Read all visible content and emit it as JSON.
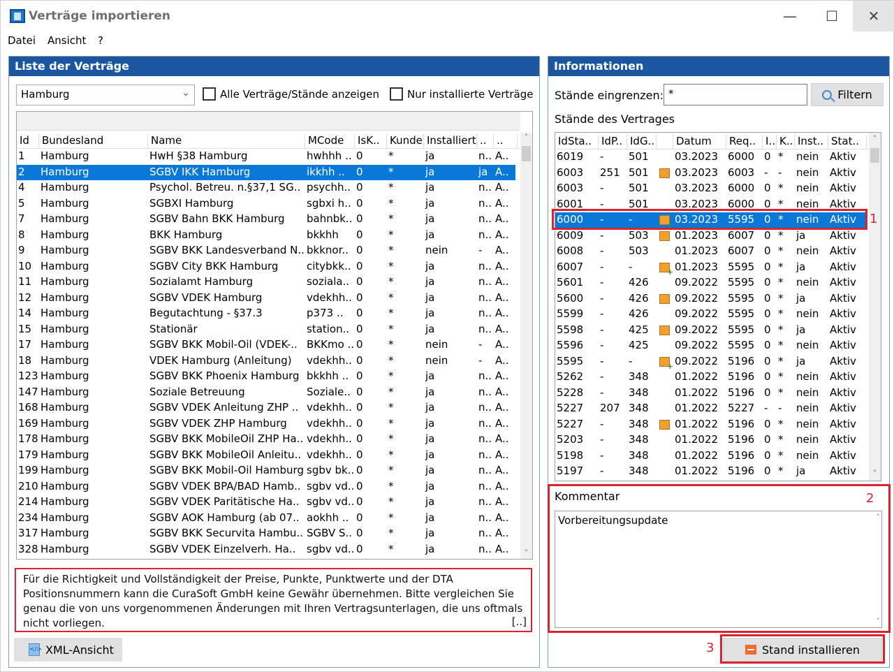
{
  "window": {
    "title": "Verträge importieren",
    "min_glyph": "—",
    "max_glyph": "☐",
    "close_glyph": "✕"
  },
  "menu": [
    "Datei",
    "Ansicht",
    "?"
  ],
  "left_panel": {
    "header": "Liste der Verträge",
    "region_select": {
      "value": "Hamburg"
    },
    "checkbox_all": {
      "label": "Alle Verträge/Stände anzeigen",
      "checked": false
    },
    "checkbox_installed": {
      "label": "Nur installierte Verträge",
      "checked": false
    },
    "columns": [
      "Id",
      "Bundesland",
      "Name",
      "MCode",
      "IsK..",
      "Kunde",
      "Installiert",
      "..",
      ".."
    ],
    "selected_row": 1,
    "rows": [
      [
        "1",
        "Hamburg",
        "HwH §38 Hamburg",
        "hwhhh ..",
        "0",
        "*",
        "ja",
        "n..",
        "A.."
      ],
      [
        "2",
        "Hamburg",
        "SGBV IKK Hamburg",
        "ikkhh ..",
        "0",
        "*",
        "ja",
        "ja",
        "A.."
      ],
      [
        "4",
        "Hamburg",
        "Psychol. Betreu. n.§37,1 SG..",
        "psychh..",
        "0",
        "*",
        "ja",
        "n..",
        "A.."
      ],
      [
        "5",
        "Hamburg",
        "SGBXI Hamburg",
        "sgbxi h..",
        "0",
        "*",
        "ja",
        "n..",
        "A.."
      ],
      [
        "7",
        "Hamburg",
        "SGBV Bahn BKK Hamburg",
        "bahnbk..",
        "0",
        "*",
        "ja",
        "n..",
        "A.."
      ],
      [
        "8",
        "Hamburg",
        "BKK Hamburg",
        "bkkhh",
        "0",
        "*",
        "ja",
        "n..",
        "A.."
      ],
      [
        "9",
        "Hamburg",
        "SGBV BKK Landesverband N..",
        "bkknor..",
        "0",
        "*",
        "nein",
        "-",
        "A.."
      ],
      [
        "10",
        "Hamburg",
        "SGBV City BKK Hamburg",
        "citybkk..",
        "0",
        "*",
        "ja",
        "n..",
        "A.."
      ],
      [
        "11",
        "Hamburg",
        "Sozialamt Hamburg",
        "soziala..",
        "0",
        "*",
        "ja",
        "n..",
        "A.."
      ],
      [
        "12",
        "Hamburg",
        "SGBV VDEK Hamburg",
        "vdekhh..",
        "0",
        "*",
        "ja",
        "n..",
        "A.."
      ],
      [
        "14",
        "Hamburg",
        "Begutachtung - §37.3",
        "p373 ..",
        "0",
        "*",
        "ja",
        "n..",
        "A.."
      ],
      [
        "15",
        "Hamburg",
        "Stationär",
        "station..",
        "0",
        "*",
        "ja",
        "n..",
        "A.."
      ],
      [
        "17",
        "Hamburg",
        "SGBV BKK Mobil-Oil (VDEK-..",
        "BKKmo ..",
        "0",
        "*",
        "nein",
        "-",
        "A.."
      ],
      [
        "18",
        "Hamburg",
        "VDEK Hamburg (Anleitung)",
        "vdekhh..",
        "0",
        "*",
        "nein",
        "-",
        "A.."
      ],
      [
        "123",
        "Hamburg",
        "SGBV BKK Phoenix Hamburg",
        "bkkhh ..",
        "0",
        "*",
        "ja",
        "n..",
        "A.."
      ],
      [
        "147",
        "Hamburg",
        "Soziale Betreuung",
        "Soziale..",
        "0",
        "*",
        "ja",
        "n..",
        "A.."
      ],
      [
        "168",
        "Hamburg",
        "SGBV VDEK Anleitung ZHP ..",
        "vdekhh..",
        "0",
        "*",
        "ja",
        "n..",
        "A.."
      ],
      [
        "169",
        "Hamburg",
        "SGBV VDEK ZHP Hamburg",
        "vdekhh..",
        "0",
        "*",
        "ja",
        "n..",
        "A.."
      ],
      [
        "178",
        "Hamburg",
        "SGBV BKK MobileOil ZHP Ha..",
        "vdekhh..",
        "0",
        "*",
        "ja",
        "n..",
        "A.."
      ],
      [
        "179",
        "Hamburg",
        "SGBV BKK MobileOil Anleitu..",
        "vdekhh..",
        "0",
        "*",
        "ja",
        "n..",
        "A.."
      ],
      [
        "199",
        "Hamburg",
        "SGBV BKK Mobil-Oil Hamburg",
        "sgbv bk..",
        "0",
        "*",
        "ja",
        "n..",
        "A.."
      ],
      [
        "210",
        "Hamburg",
        "SGBV VDEK BPA/BAD Hamb..",
        "sgbv vd..",
        "0",
        "*",
        "ja",
        "n..",
        "A.."
      ],
      [
        "214",
        "Hamburg",
        "SGBV VDEK Paritätische Ha..",
        "sgbv vd..",
        "0",
        "*",
        "ja",
        "n..",
        "A.."
      ],
      [
        "234",
        "Hamburg",
        "SGBV AOK Hamburg (ab 07..",
        "aokhh ..",
        "0",
        "*",
        "ja",
        "n..",
        "A.."
      ],
      [
        "317",
        "Hamburg",
        "SGBV BKK Securvita Hambu..",
        "SGBV S..",
        "0",
        "*",
        "ja",
        "n..",
        "A.."
      ],
      [
        "328",
        "Hamburg",
        "SGBV VDEK Einzelverh. Ha..",
        "sgbv vd..",
        "0",
        "*",
        "ja",
        "n..",
        "A.."
      ]
    ],
    "notice": "Für die Richtigkeit und Vollständigkeit der Preise, Punkte, Punktwerte und der DTA Positionsnummern kann die CuraSoft GmbH keine Gewähr übernehmen. Bitte vergleichen Sie genau die von uns vorgenommenen Änderungen mit Ihren Vertragsunterlagen, die uns oftmals nicht vorliegen.",
    "notice_more": "[..]",
    "xml_button": "XML-Ansicht"
  },
  "right_panel": {
    "header": "Informationen",
    "filter_label": "Stände eingrenzen:",
    "filter_value": "*",
    "filter_button": "Filtern",
    "states_label": "Stände des Vertrages",
    "columns": [
      "IdSta..",
      "IdP..",
      "IdG..",
      "",
      "Datum",
      "Req..",
      "I..",
      "K..",
      "Inst..",
      "Stat.."
    ],
    "selected_row": 4,
    "rows": [
      [
        "6019",
        "-",
        "501",
        "",
        "03.2023",
        "6000",
        "0",
        "*",
        "nein",
        "Aktiv"
      ],
      [
        "6003",
        "251",
        "501",
        "pkg",
        "03.2023",
        "6003",
        "-",
        "-",
        "nein",
        "Aktiv"
      ],
      [
        "6003",
        "-",
        "501",
        "",
        "03.2023",
        "6000",
        "0",
        "*",
        "nein",
        "Aktiv"
      ],
      [
        "6001",
        "-",
        "501",
        "",
        "03.2023",
        "6000",
        "0",
        "*",
        "nein",
        "Aktiv"
      ],
      [
        "6000",
        "-",
        "-",
        "pkg-plus",
        "03.2023",
        "5595",
        "0",
        "*",
        "nein",
        "Aktiv"
      ],
      [
        "6009",
        "-",
        "503",
        "pkg",
        "01.2023",
        "6007",
        "0",
        "*",
        "ja",
        "Aktiv"
      ],
      [
        "6008",
        "-",
        "503",
        "",
        "01.2023",
        "6007",
        "0",
        "*",
        "nein",
        "Aktiv"
      ],
      [
        "6007",
        "-",
        "-",
        "pkg-plus",
        "01.2023",
        "5595",
        "0",
        "*",
        "ja",
        "Aktiv"
      ],
      [
        "5601",
        "-",
        "426",
        "",
        "09.2022",
        "5595",
        "0",
        "*",
        "nein",
        "Aktiv"
      ],
      [
        "5600",
        "-",
        "426",
        "pkg",
        "09.2022",
        "5595",
        "0",
        "*",
        "ja",
        "Aktiv"
      ],
      [
        "5599",
        "-",
        "426",
        "",
        "09.2022",
        "5595",
        "0",
        "*",
        "nein",
        "Aktiv"
      ],
      [
        "5598",
        "-",
        "425",
        "pkg",
        "09.2022",
        "5595",
        "0",
        "*",
        "ja",
        "Aktiv"
      ],
      [
        "5596",
        "-",
        "425",
        "",
        "09.2022",
        "5595",
        "0",
        "*",
        "nein",
        "Aktiv"
      ],
      [
        "5595",
        "-",
        "-",
        "pkg-plus",
        "09.2022",
        "5196",
        "0",
        "*",
        "ja",
        "Aktiv"
      ],
      [
        "5262",
        "-",
        "348",
        "",
        "01.2022",
        "5196",
        "0",
        "*",
        "nein",
        "Aktiv"
      ],
      [
        "5228",
        "-",
        "348",
        "",
        "01.2022",
        "5196",
        "0",
        "*",
        "nein",
        "Aktiv"
      ],
      [
        "5227",
        "207",
        "348",
        "",
        "01.2022",
        "5227",
        "-",
        "-",
        "nein",
        "Aktiv"
      ],
      [
        "5227",
        "-",
        "348",
        "pkg",
        "01.2022",
        "5196",
        "0",
        "*",
        "nein",
        "Aktiv"
      ],
      [
        "5203",
        "-",
        "348",
        "",
        "01.2022",
        "5196",
        "0",
        "*",
        "nein",
        "Aktiv"
      ],
      [
        "5198",
        "-",
        "348",
        "",
        "01.2022",
        "5196",
        "0",
        "*",
        "nein",
        "Aktiv"
      ],
      [
        "5197",
        "-",
        "348",
        "",
        "01.2022",
        "5196",
        "0",
        "*",
        "ja",
        "Aktiv"
      ]
    ],
    "comment_label": "Kommentar",
    "comment_text": "Vorbereitungsupdate",
    "install_button": "Stand installieren"
  },
  "callouts": [
    "1",
    "2",
    "3"
  ],
  "colors": {
    "accent": "#1a57a0",
    "selection": "#0a78d7",
    "callout": "#d9232f"
  }
}
